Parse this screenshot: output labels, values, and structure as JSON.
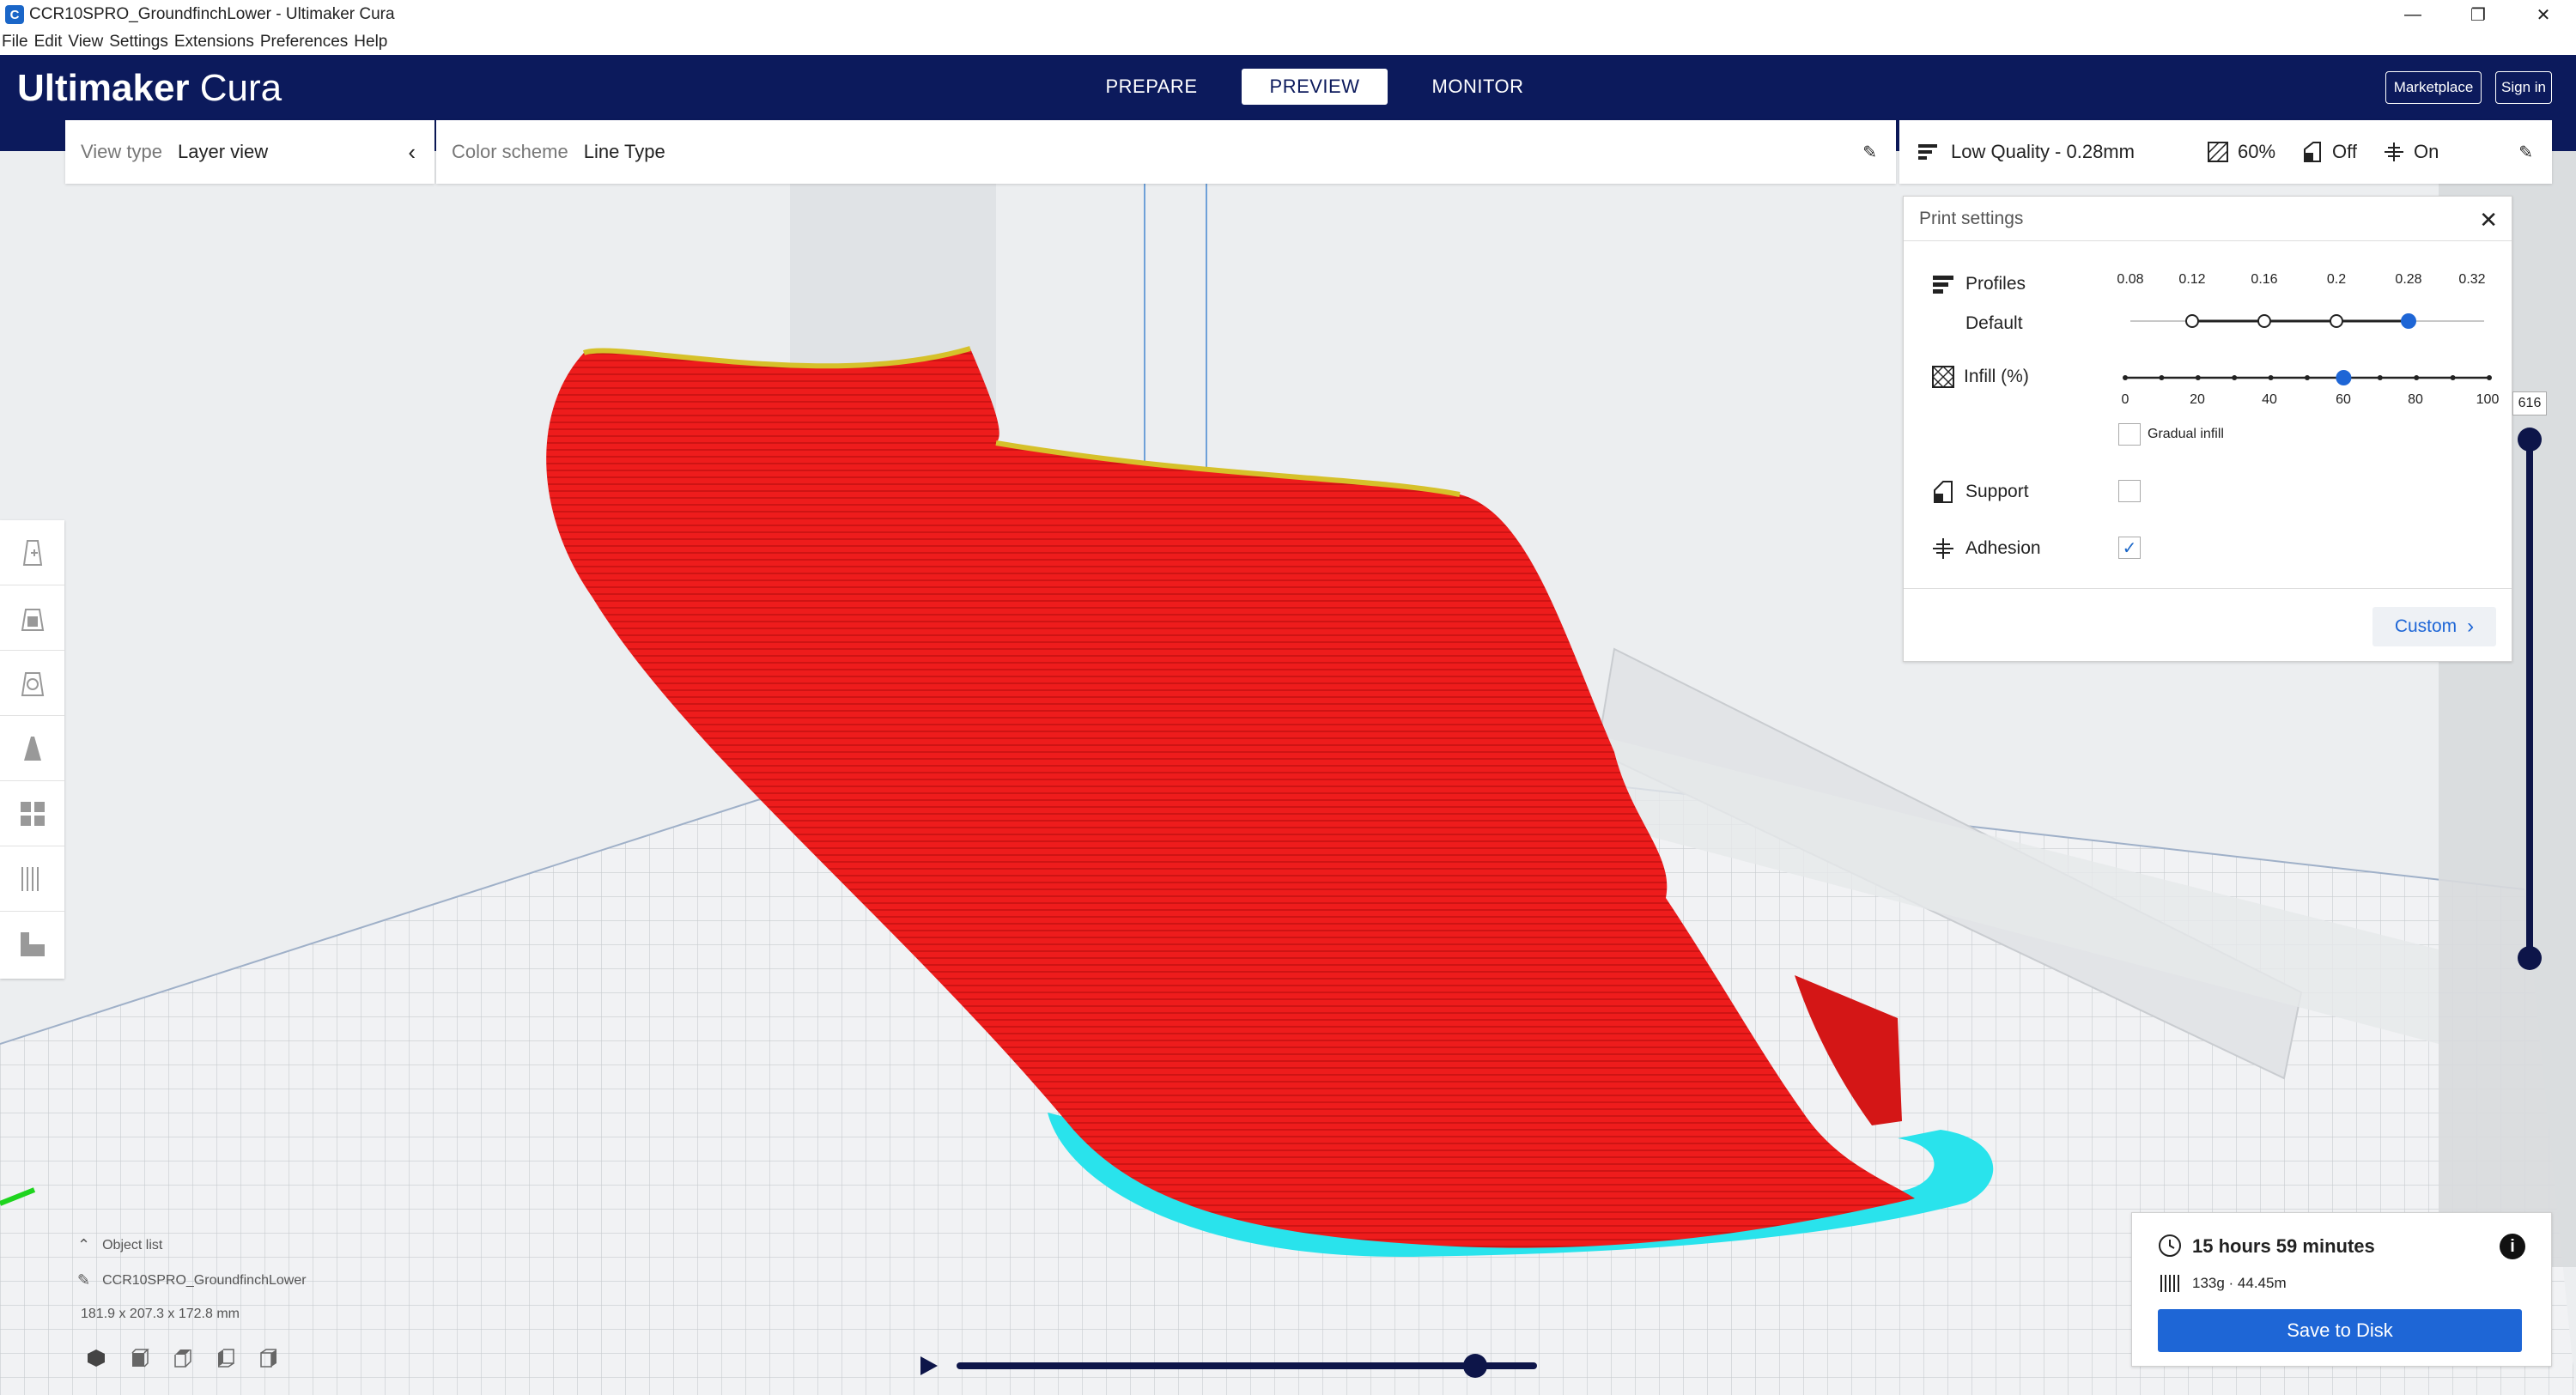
{
  "window": {
    "title": "CCR10SPRO_GroundfinchLower - Ultimaker Cura",
    "controls": [
      "—",
      "❐",
      "✕"
    ]
  },
  "menubar": [
    "File",
    "Edit",
    "View",
    "Settings",
    "Extensions",
    "Preferences",
    "Help"
  ],
  "header": {
    "brand_bold": "Ultimaker",
    "brand_light": "Cura",
    "tabs": [
      {
        "label": "PREPARE",
        "active": false
      },
      {
        "label": "PREVIEW",
        "active": true
      },
      {
        "label": "MONITOR",
        "active": false
      }
    ],
    "marketplace": "Marketplace",
    "sign_in": "Sign in"
  },
  "view_panel": {
    "label": "View type",
    "value": "Layer view"
  },
  "color_panel": {
    "label": "Color scheme",
    "value": "Line Type"
  },
  "print_bar": {
    "profile": "Low Quality - 0.28mm",
    "infill": "60%",
    "support": "Off",
    "adhesion": "On"
  },
  "print_settings": {
    "title": "Print settings",
    "profiles_label": "Profiles",
    "profiles_value": "Default",
    "layer_heights": [
      "0.08",
      "0.12",
      "0.16",
      "0.2",
      "0.28",
      "0.32"
    ],
    "selected_layer_height": "0.28",
    "infill_label": "Infill (%)",
    "infill_ticks": [
      "0",
      "20",
      "40",
      "60",
      "80",
      "100"
    ],
    "infill_value": 60,
    "gradual_infill": "Gradual infill",
    "support_label": "Support",
    "support_checked": false,
    "adhesion_label": "Adhesion",
    "adhesion_checked": true,
    "custom_button": "Custom"
  },
  "layer_slider": {
    "max_layer": "616"
  },
  "object_list": {
    "label": "Object list",
    "object_name": "CCR10SPRO_GroundfinchLower",
    "dimensions": "181.9 x 207.3 x 172.8 mm"
  },
  "print_info": {
    "time": "15 hours 59 minutes",
    "material": "133g · 44.45m",
    "save_button": "Save to Disk"
  },
  "colors": {
    "header": "#0c1a5c",
    "accent": "#1e66d6",
    "model": "#ee1c1c",
    "skirt": "#29e3ec",
    "progress": "#0d1549"
  }
}
